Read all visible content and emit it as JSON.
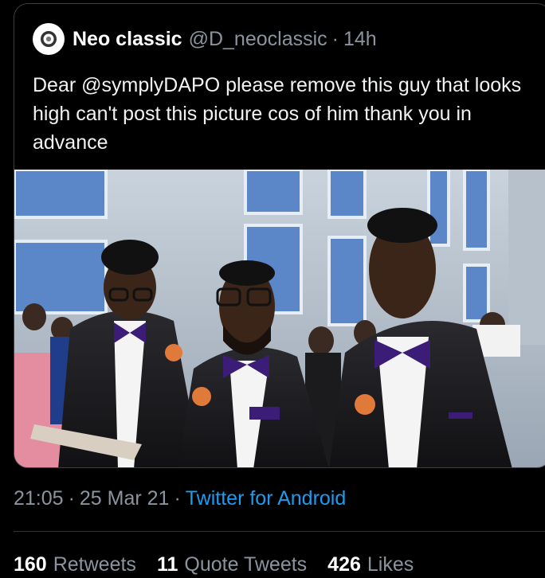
{
  "quoted_tweet": {
    "display_name": "Neo classic",
    "handle": "@D_neoclassic",
    "separator": "·",
    "time": "14h",
    "text": "Dear @symplyDAPO please remove this guy that looks high can't post this picture cos of him thank you in advance",
    "photo_icon": "photo-of-three-groomsmen"
  },
  "tweet_meta": {
    "time": "21:05",
    "separator": "·",
    "date": "25 Mar 21",
    "separator2": "·",
    "source": "Twitter for Android"
  },
  "stats": {
    "retweets_count": "160",
    "retweets_label": "Retweets",
    "quote_count": "11",
    "quote_label": "Quote Tweets",
    "likes_count": "426",
    "likes_label": "Likes"
  },
  "colors": {
    "background": "#000000",
    "accent": "#1d9bf0",
    "muted": "#8b949e",
    "border": "#3a3f44"
  }
}
